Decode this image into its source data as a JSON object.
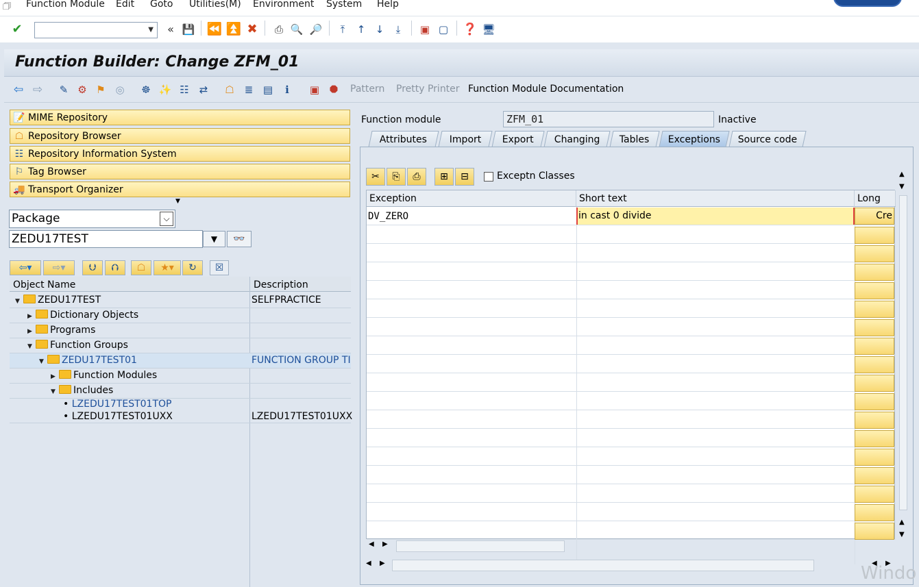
{
  "menu": {
    "items": [
      "Function Module",
      "Edit",
      "Goto",
      "Utilities(M)",
      "Environment",
      "System",
      "Help"
    ]
  },
  "title": "Function Builder: Change ZFM_01",
  "app_toolbar": {
    "pattern": "Pattern",
    "pretty_printer": "Pretty Printer",
    "fm_doc": "Function Module Documentation"
  },
  "nav_buttons": [
    "MIME Repository",
    "Repository Browser",
    "Repository Information System",
    "Tag Browser",
    "Transport Organizer"
  ],
  "object_type": "Package",
  "object_name": "ZEDU17TEST",
  "tree": {
    "col_name": "Object Name",
    "col_desc": "Description",
    "rows": [
      {
        "name": "ZEDU17TEST",
        "desc": "SELFPRACTICE"
      },
      {
        "name": "Dictionary Objects",
        "desc": ""
      },
      {
        "name": "Programs",
        "desc": ""
      },
      {
        "name": "Function Groups",
        "desc": ""
      },
      {
        "name": "ZEDU17TEST01",
        "desc": "FUNCTION GROUP TI"
      },
      {
        "name": "Function Modules",
        "desc": ""
      },
      {
        "name": "Includes",
        "desc": ""
      },
      {
        "name": "LZEDU17TEST01TOP",
        "desc": ""
      },
      {
        "name": "LZEDU17TEST01UXX",
        "desc": "LZEDU17TEST01UXX"
      }
    ]
  },
  "fm": {
    "label": "Function module",
    "value": "ZFM_01",
    "status": "Inactive"
  },
  "tabs": [
    "Attributes",
    "Import",
    "Export",
    "Changing",
    "Tables",
    "Exceptions",
    "Source code"
  ],
  "active_tab": "Exceptions",
  "exceptions": {
    "classes_label": "Exceptn Classes",
    "classes_checked": false,
    "headers": [
      "Exception",
      "Short text",
      "Long txt"
    ],
    "rows": [
      {
        "exception": "DV_ZERO",
        "short_text": "in cast 0 divide",
        "long_txt": "Cre"
      }
    ]
  },
  "watermark": "Windo"
}
